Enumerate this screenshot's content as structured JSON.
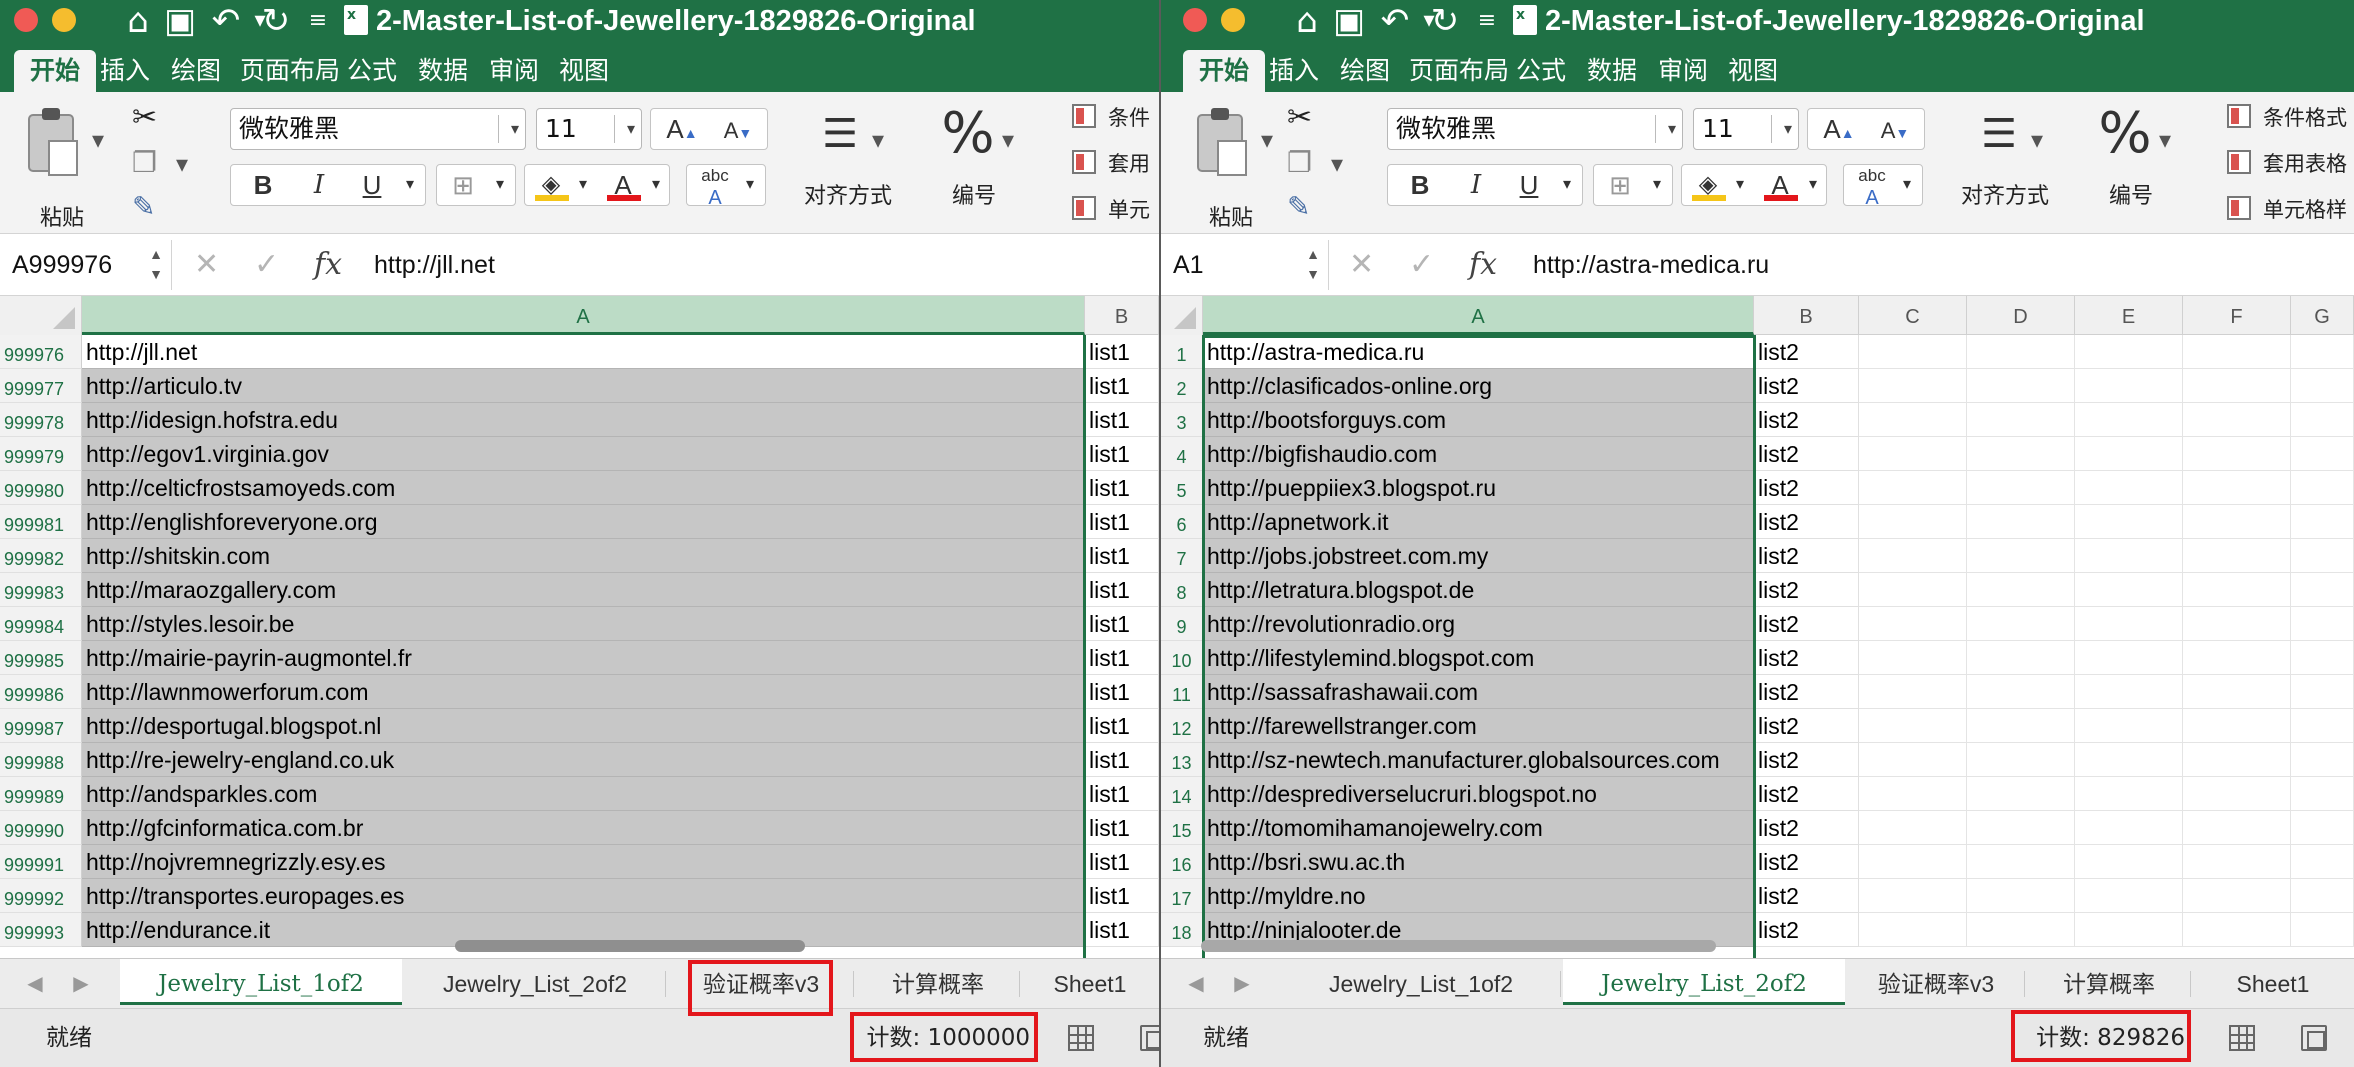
{
  "left": {
    "doc_title": "2-Master-List-of-Jewellery-1829826-Original",
    "ribbon_tabs": [
      "开始",
      "插入",
      "绘图",
      "页面布局",
      "公式",
      "数据",
      "审阅",
      "视图"
    ],
    "ribbon": {
      "paste": "粘贴",
      "font_name": "微软雅黑",
      "font_size": "11",
      "grow": "A",
      "shrink": "A",
      "bold": "B",
      "italic": "I",
      "underline": "U",
      "font_color": "A",
      "abc": "abc",
      "align": "对齐方式",
      "number_symbol": "%",
      "number": "编号",
      "cond": [
        "条件",
        "套用",
        "单元"
      ]
    },
    "name_box": "A999976",
    "formula": "http://jll.net",
    "columns": [
      "A",
      "B"
    ],
    "rows": [
      {
        "n": "999976",
        "a": "http://jll.net",
        "b": "list1"
      },
      {
        "n": "999977",
        "a": "http://articulo.tv",
        "b": "list1"
      },
      {
        "n": "999978",
        "a": "http://idesign.hofstra.edu",
        "b": "list1"
      },
      {
        "n": "999979",
        "a": "http://egov1.virginia.gov",
        "b": "list1"
      },
      {
        "n": "999980",
        "a": "http://celticfrostsamoyeds.com",
        "b": "list1"
      },
      {
        "n": "999981",
        "a": "http://englishforeveryone.org",
        "b": "list1"
      },
      {
        "n": "999982",
        "a": "http://shitskin.com",
        "b": "list1"
      },
      {
        "n": "999983",
        "a": "http://maraozgallery.com",
        "b": "list1"
      },
      {
        "n": "999984",
        "a": "http://styles.lesoir.be",
        "b": "list1"
      },
      {
        "n": "999985",
        "a": "http://mairie-payrin-augmontel.fr",
        "b": "list1"
      },
      {
        "n": "999986",
        "a": "http://lawnmowerforum.com",
        "b": "list1"
      },
      {
        "n": "999987",
        "a": "http://desportugal.blogspot.nl",
        "b": "list1"
      },
      {
        "n": "999988",
        "a": "http://re-jewelry-england.co.uk",
        "b": "list1"
      },
      {
        "n": "999989",
        "a": "http://andsparkles.com",
        "b": "list1"
      },
      {
        "n": "999990",
        "a": "http://gfcinformatica.com.br",
        "b": "list1"
      },
      {
        "n": "999991",
        "a": "http://nojvremnegrizzly.esy.es",
        "b": "list1"
      },
      {
        "n": "999992",
        "a": "http://transportes.europages.es",
        "b": "list1"
      },
      {
        "n": "999993",
        "a": "http://endurance.it",
        "b": "list1"
      }
    ],
    "sheet_tabs": [
      "Jewelry_List_1of2",
      "Jewelry_List_2of2",
      "验证概率v3",
      "计算概率",
      "Sheet1"
    ],
    "status": "就绪",
    "count": "计数: 1000000"
  },
  "right": {
    "doc_title": "2-Master-List-of-Jewellery-1829826-Original",
    "ribbon_tabs": [
      "开始",
      "插入",
      "绘图",
      "页面布局",
      "公式",
      "数据",
      "审阅",
      "视图"
    ],
    "ribbon": {
      "paste": "粘贴",
      "font_name": "微软雅黑",
      "font_size": "11",
      "grow": "A",
      "shrink": "A",
      "bold": "B",
      "italic": "I",
      "underline": "U",
      "font_color": "A",
      "abc": "abc",
      "align": "对齐方式",
      "number_symbol": "%",
      "number": "编号",
      "cond": [
        "条件格式",
        "套用表格",
        "单元格样"
      ]
    },
    "name_box": "A1",
    "formula": "http://astra-medica.ru",
    "columns": [
      "A",
      "B",
      "C",
      "D",
      "E",
      "F",
      "G"
    ],
    "rows": [
      {
        "n": "1",
        "a": "http://astra-medica.ru",
        "b": "list2"
      },
      {
        "n": "2",
        "a": "http://clasificados-online.org",
        "b": "list2"
      },
      {
        "n": "3",
        "a": "http://bootsforguys.com",
        "b": "list2"
      },
      {
        "n": "4",
        "a": "http://bigfishaudio.com",
        "b": "list2"
      },
      {
        "n": "5",
        "a": "http://pueppiiex3.blogspot.ru",
        "b": "list2"
      },
      {
        "n": "6",
        "a": "http://apnetwork.it",
        "b": "list2"
      },
      {
        "n": "7",
        "a": "http://jobs.jobstreet.com.my",
        "b": "list2"
      },
      {
        "n": "8",
        "a": "http://letratura.blogspot.de",
        "b": "list2"
      },
      {
        "n": "9",
        "a": "http://revolutionradio.org",
        "b": "list2"
      },
      {
        "n": "10",
        "a": "http://lifestylemind.blogspot.com",
        "b": "list2"
      },
      {
        "n": "11",
        "a": "http://sassafrashawaii.com",
        "b": "list2"
      },
      {
        "n": "12",
        "a": "http://farewellstranger.com",
        "b": "list2"
      },
      {
        "n": "13",
        "a": "http://sz-newtech.manufacturer.globalsources.com",
        "b": "list2"
      },
      {
        "n": "14",
        "a": "http://desprediverselucruri.blogspot.no",
        "b": "list2"
      },
      {
        "n": "15",
        "a": "http://tomomihamanojewelry.com",
        "b": "list2"
      },
      {
        "n": "16",
        "a": "http://bsri.swu.ac.th",
        "b": "list2"
      },
      {
        "n": "17",
        "a": "http://myldre.no",
        "b": "list2"
      },
      {
        "n": "18",
        "a": "http://ninjalooter.de",
        "b": "list2"
      }
    ],
    "sheet_tabs": [
      "Jewelry_List_1of2",
      "Jewelry_List_2of2",
      "验证概率v3",
      "计算概率",
      "Sheet1"
    ],
    "status": "就绪",
    "count": "计数: 829826"
  },
  "colors": {
    "excel_green": "#1f7145",
    "selection_gray": "#c7c7c7",
    "highlight_red": "#e3161b"
  },
  "icons": {
    "quick_access": [
      "home-icon",
      "save-icon",
      "undo-icon",
      "redo-icon",
      "customize-icon"
    ],
    "formula_bar": [
      "cancel-icon",
      "enter-icon",
      "fx-icon"
    ]
  }
}
